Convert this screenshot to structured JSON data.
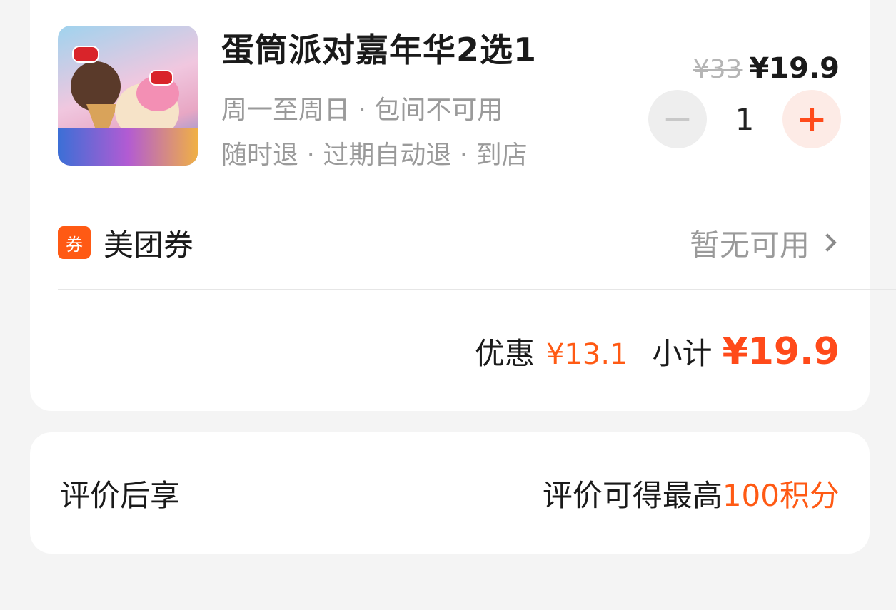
{
  "product": {
    "title": "蛋筒派对嘉年华2选1",
    "meta_line1": "周一至周日 · 包间不可用",
    "meta_line2": "随时退 · 过期自动退 · 到店",
    "original_price": "¥33",
    "price": "¥19.9",
    "quantity": "1",
    "minus_symbol": "−",
    "plus_symbol": "+",
    "image_icon": "dq-ice-cream-cone-photo"
  },
  "coupon": {
    "badge": "券",
    "label": "美团券",
    "status": "暂无可用",
    "chevron_icon": "chevron-right-icon"
  },
  "summary": {
    "discount_label": "优惠",
    "discount_value": "¥13.1",
    "subtotal_label": "小计",
    "subtotal_value": "¥19.9"
  },
  "review": {
    "label": "评价后享",
    "reward_text": "评价可得最高",
    "reward_points": "100积分"
  },
  "colors": {
    "accent": "#ff5a14",
    "plus_bg": "#fdebe6",
    "page_bg": "#f4f4f4"
  }
}
